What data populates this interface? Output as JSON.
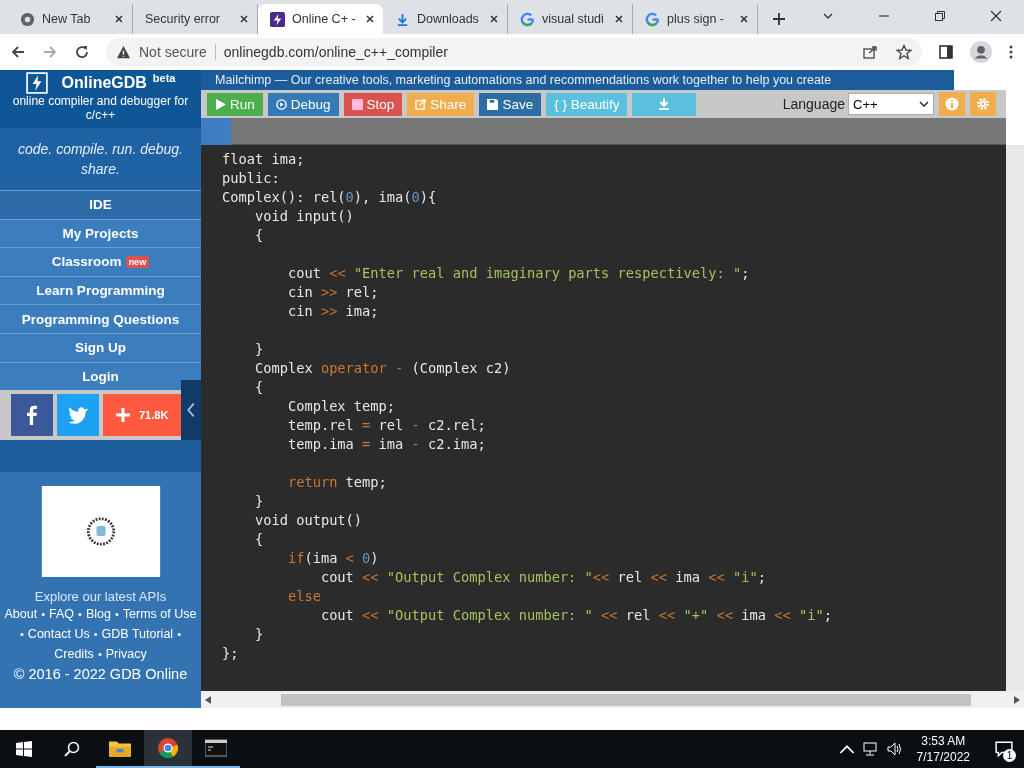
{
  "browser": {
    "tabs": [
      {
        "label": "New Tab",
        "selected": false
      },
      {
        "label": "Security error",
        "selected": false
      },
      {
        "label": "Online C+ -",
        "selected": true
      },
      {
        "label": "Downloads",
        "selected": false
      },
      {
        "label": "visual studi",
        "selected": false
      },
      {
        "label": "plus sign -",
        "selected": false
      }
    ],
    "security": "Not secure",
    "url": "onlinegdb.com/online_c++_compiler"
  },
  "sidebar": {
    "brand": "OnlineGDB",
    "brand_badge": "beta",
    "subtitle": "online compiler and debugger for c/c++",
    "tagline": "code. compile. run. debug. share.",
    "nav": [
      {
        "label": "IDE",
        "selected": true
      },
      {
        "label": "My Projects",
        "selected": false
      },
      {
        "label": "Classroom",
        "badge": "new",
        "selected": false
      },
      {
        "label": "Learn Programming",
        "selected": false
      },
      {
        "label": "Programming Questions",
        "selected": false
      },
      {
        "label": "Sign Up",
        "selected": false
      },
      {
        "label": "Login",
        "selected": false
      }
    ],
    "share_count": "71.8K",
    "ad_text": "Explore our latest APIs",
    "footer_rows": [
      [
        {
          "text": "About",
          "kind": "link"
        },
        {
          "text": "•",
          "kind": "sep"
        },
        {
          "text": "FAQ",
          "kind": "link"
        },
        {
          "text": "•",
          "kind": "sep"
        },
        {
          "text": "Blog",
          "kind": "link"
        },
        {
          "text": "•",
          "kind": "sep"
        },
        {
          "text": "Terms of Use",
          "kind": "link"
        }
      ],
      [
        {
          "text": "•",
          "kind": "sep"
        },
        {
          "text": "Contact Us",
          "kind": "link"
        },
        {
          "text": "•",
          "kind": "sep"
        },
        {
          "text": "GDB Tutorial",
          "kind": "link"
        },
        {
          "text": "•",
          "kind": "sep"
        }
      ],
      [
        {
          "text": "Credits",
          "kind": "link"
        },
        {
          "text": "•",
          "kind": "sep"
        },
        {
          "text": "Privacy",
          "kind": "link"
        }
      ]
    ],
    "copyright": "© 2016 - 2022 GDB Online"
  },
  "banner": "Mailchimp — Our creative tools, marketing automations and recommendations work together to help you create",
  "toolbar": {
    "buttons": [
      {
        "label": "Run",
        "kind": "run"
      },
      {
        "label": "Debug",
        "kind": "debug"
      },
      {
        "label": "Stop",
        "kind": "stop"
      },
      {
        "label": "Share",
        "kind": "share"
      },
      {
        "label": "Save",
        "kind": "save"
      },
      {
        "label": "{ } Beautify",
        "kind": "beautify"
      },
      {
        "kind": "download"
      }
    ],
    "language_label": "Language",
    "language": "C++"
  },
  "code": [
    {
      "tokens": [
        {
          "text": "float ima;",
          "kind": "plain"
        }
      ]
    },
    {
      "tokens": [
        {
          "text": "public:",
          "kind": "plain"
        }
      ]
    },
    {
      "tokens": [
        {
          "text": "Complex(): rel(",
          "kind": "plain"
        },
        {
          "text": "0",
          "kind": "num"
        },
        {
          "text": "), ima(",
          "kind": "plain"
        },
        {
          "text": "0",
          "kind": "num"
        },
        {
          "text": "){",
          "kind": "plain"
        }
      ]
    },
    {
      "tokens": [
        {
          "text": "    void input()",
          "kind": "plain"
        }
      ]
    },
    {
      "tokens": [
        {
          "text": "    {",
          "kind": "plain"
        }
      ],
      "blank_after": true
    },
    {
      "tokens": [
        {
          "text": "        cout ",
          "kind": "plain"
        },
        {
          "text": "<< ",
          "kind": "op"
        },
        {
          "text": "\"Enter real and imaginary parts respectively: \"",
          "kind": "str"
        },
        {
          "text": ";",
          "kind": "plain"
        }
      ]
    },
    {
      "tokens": [
        {
          "text": "        cin ",
          "kind": "plain"
        },
        {
          "text": ">>",
          "kind": "op"
        },
        {
          "text": " rel;",
          "kind": "plain"
        }
      ]
    },
    {
      "tokens": [
        {
          "text": "        cin ",
          "kind": "plain"
        },
        {
          "text": ">>",
          "kind": "op"
        },
        {
          "text": " ima;",
          "kind": "plain"
        }
      ],
      "blank_after": true
    },
    {
      "tokens": [
        {
          "text": "    }",
          "kind": "plain"
        }
      ]
    },
    {
      "tokens": [
        {
          "text": "    Complex ",
          "kind": "plain"
        },
        {
          "text": "operator -",
          "kind": "kw"
        },
        {
          "text": " (Complex c2)",
          "kind": "plain"
        }
      ]
    },
    {
      "tokens": [
        {
          "text": "    {",
          "kind": "plain"
        }
      ]
    },
    {
      "tokens": [
        {
          "text": "        Complex temp;",
          "kind": "plain"
        }
      ]
    },
    {
      "tokens": [
        {
          "text": "        temp.rel ",
          "kind": "plain"
        },
        {
          "text": "=",
          "kind": "op"
        },
        {
          "text": " rel ",
          "kind": "plain"
        },
        {
          "text": "-",
          "kind": "op"
        },
        {
          "text": " c2.rel;",
          "kind": "plain"
        }
      ]
    },
    {
      "tokens": [
        {
          "text": "        temp.ima ",
          "kind": "plain"
        },
        {
          "text": "=",
          "kind": "op"
        },
        {
          "text": " ima ",
          "kind": "plain"
        },
        {
          "text": "-",
          "kind": "op"
        },
        {
          "text": " c2.ima;",
          "kind": "plain"
        }
      ],
      "blank_after": true
    },
    {
      "tokens": [
        {
          "text": "        return",
          "kind": "kw"
        },
        {
          "text": " temp;",
          "kind": "plain"
        }
      ]
    },
    {
      "tokens": [
        {
          "text": "    }",
          "kind": "plain"
        }
      ]
    },
    {
      "tokens": [
        {
          "text": "    void output()",
          "kind": "plain"
        }
      ]
    },
    {
      "tokens": [
        {
          "text": "    {",
          "kind": "plain"
        }
      ]
    },
    {
      "tokens": [
        {
          "text": "        if",
          "kind": "kw"
        },
        {
          "text": "(ima ",
          "kind": "plain"
        },
        {
          "text": "< ",
          "kind": "op"
        },
        {
          "text": "0",
          "kind": "num"
        },
        {
          "text": ")",
          "kind": "plain"
        }
      ]
    },
    {
      "tokens": [
        {
          "text": "            cout ",
          "kind": "plain"
        },
        {
          "text": "<< ",
          "kind": "op"
        },
        {
          "text": "\"Output Complex number: \"",
          "kind": "str"
        },
        {
          "text": "<<",
          "kind": "op"
        },
        {
          "text": " rel ",
          "kind": "plain"
        },
        {
          "text": "<<",
          "kind": "op"
        },
        {
          "text": " ima ",
          "kind": "plain"
        },
        {
          "text": "<< ",
          "kind": "op"
        },
        {
          "text": "\"i\"",
          "kind": "str"
        },
        {
          "text": ";",
          "kind": "plain"
        }
      ]
    },
    {
      "tokens": [
        {
          "text": "        else",
          "kind": "kw"
        }
      ]
    },
    {
      "tokens": [
        {
          "text": "            cout ",
          "kind": "plain"
        },
        {
          "text": "<< ",
          "kind": "op"
        },
        {
          "text": "\"Output Complex number: \" ",
          "kind": "str"
        },
        {
          "text": "<<",
          "kind": "op"
        },
        {
          "text": " rel ",
          "kind": "plain"
        },
        {
          "text": "<< ",
          "kind": "op"
        },
        {
          "text": "\"+\" ",
          "kind": "str"
        },
        {
          "text": "<<",
          "kind": "op"
        },
        {
          "text": " ima ",
          "kind": "plain"
        },
        {
          "text": "<< ",
          "kind": "op"
        },
        {
          "text": "\"i\"",
          "kind": "str"
        },
        {
          "text": ";",
          "kind": "plain"
        }
      ]
    },
    {
      "tokens": [
        {
          "text": "    }",
          "kind": "plain"
        }
      ]
    },
    {
      "tokens": [
        {
          "text": "};",
          "kind": "plain"
        }
      ]
    }
  ],
  "taskbar": {
    "time": "3:53 AM",
    "date": "7/17/2022",
    "notifications": "1"
  }
}
